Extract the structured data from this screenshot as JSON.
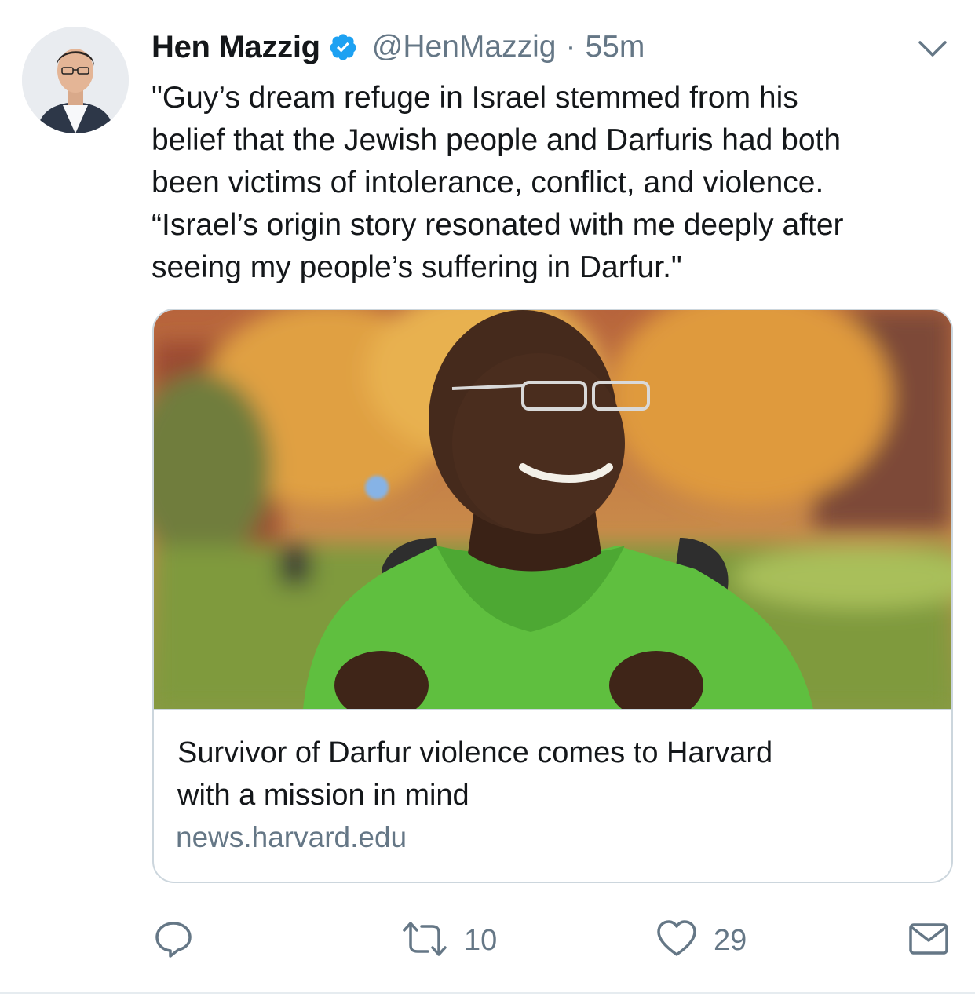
{
  "tweet": {
    "author_name": "Hen Mazzig",
    "handle": "@HenMazzig",
    "separator": "·",
    "time": "55m",
    "verified_icon": "verified-badge-icon",
    "text_lines": [
      "\"Guy’s dream refuge in Israel stemmed from his",
      "belief that the Jewish people and Darfuris had both",
      "been victims of intolerance, conflict, and violence.",
      "“Israel’s origin story resonated with me deeply after",
      "seeing my people’s suffering in Darfur.\""
    ]
  },
  "card": {
    "title_lines": [
      "Survivor of Darfur violence comes to Harvard",
      "with a mission in mind"
    ],
    "domain": "news.harvard.edu"
  },
  "actions": {
    "reply_icon": "reply-icon",
    "retweet_icon": "retweet-icon",
    "retweet_count": "10",
    "like_icon": "heart-icon",
    "like_count": "29",
    "dm_icon": "envelope-icon"
  },
  "colors": {
    "text": "#14171a",
    "secondary": "#657786",
    "verified_blue": "#1da1f2",
    "border": "#ccd6dd"
  }
}
